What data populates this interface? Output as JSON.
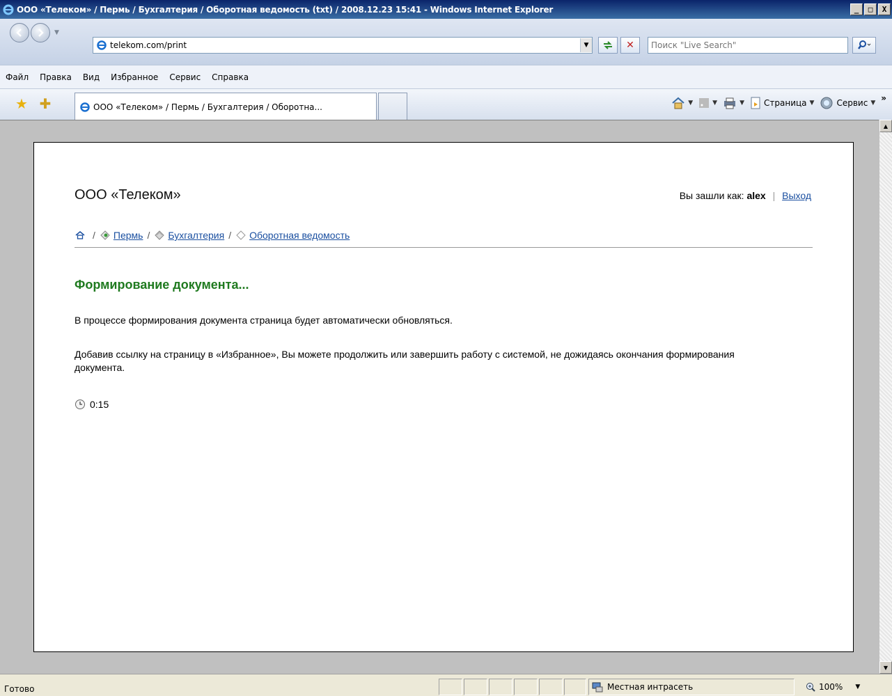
{
  "window": {
    "title": "ООО «Телеком» / Пермь / Бухгалтерия / Оборотная ведомость (txt) / 2008.12.23 15:41 - Windows Internet Explorer",
    "minimize": "_",
    "maximize": "□",
    "close": "X"
  },
  "address": {
    "url": "telekom.com/print"
  },
  "search": {
    "placeholder": "Поиск \"Live Search\""
  },
  "menu": {
    "items": [
      "Файл",
      "Правка",
      "Вид",
      "Избранное",
      "Сервис",
      "Справка"
    ]
  },
  "tab": {
    "title": "ООО «Телеком» / Пермь / Бухгалтерия / Оборотна..."
  },
  "commandbar": {
    "page_label": "Страница",
    "tools_label": "Сервис",
    "more": "»"
  },
  "page": {
    "company": "ООО «Телеком»",
    "login_prefix": "Вы зашли как:",
    "username": "alex",
    "logout": "Выход",
    "breadcrumbs": [
      "Пермь",
      "Бухгалтерия",
      "Оборотная ведомость"
    ],
    "heading": "Формирование документа...",
    "paragraph1": "В процессе формирования документа страница будет автоматически обновляться.",
    "paragraph2": "Добавив ссылку на страницу в «Избранное», Вы можете продолжить или завершить работу с системой, не дожидаясь окончания формирования документа.",
    "timer": "0:15"
  },
  "status": {
    "text": "Готово",
    "zone": "Местная интрасеть",
    "zoom": "100%"
  },
  "colors": {
    "heading": "#1f7a1f",
    "link": "#1a4fa0"
  }
}
